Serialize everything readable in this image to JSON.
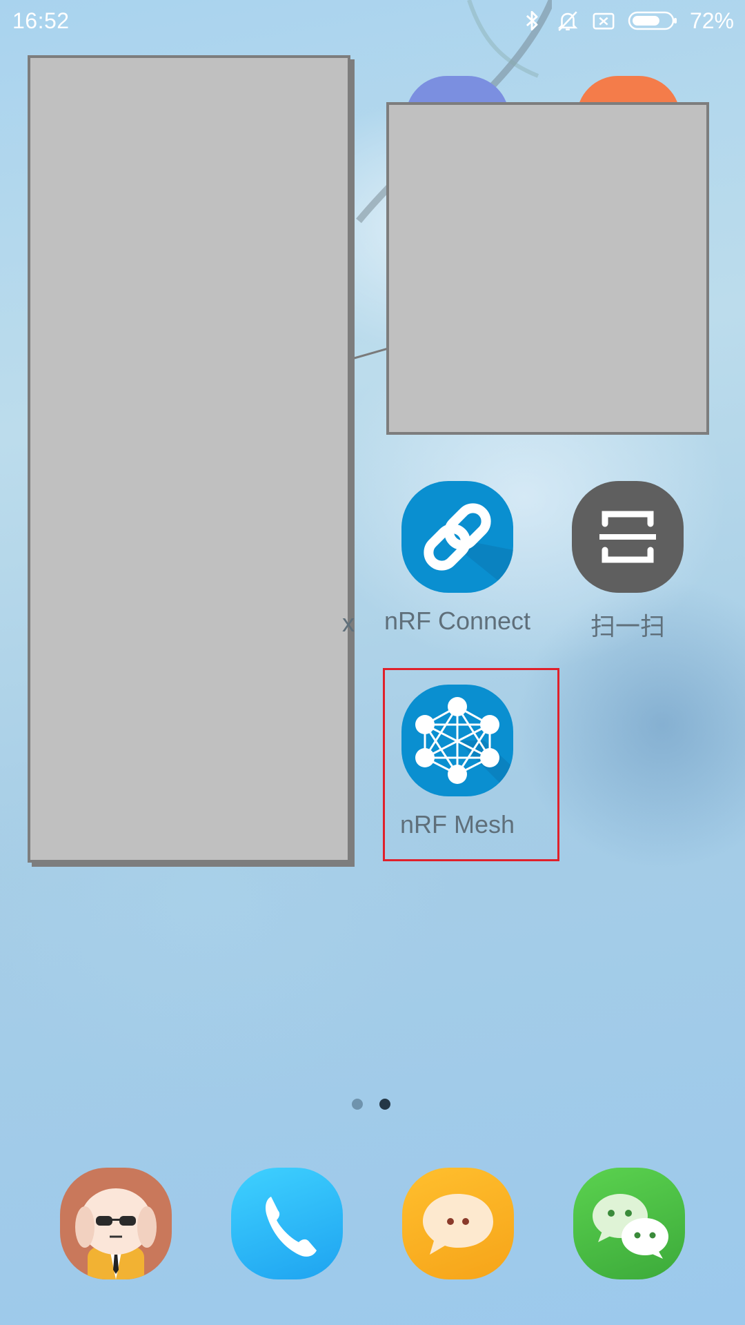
{
  "status_bar": {
    "time": "16:52",
    "battery_percent": "72%",
    "battery_level": 0.72,
    "icons": [
      "bluetooth-icon",
      "bell-muted-icon",
      "no-sim-icon",
      "battery-icon"
    ]
  },
  "home": {
    "apps": [
      {
        "label": "nRF Connect",
        "icon": "linked-chain-icon",
        "color": "#0a8fd0"
      },
      {
        "label": "扫一扫",
        "icon": "scan-frame-icon",
        "color": "#5f5f5f"
      },
      {
        "label": "nRF Mesh",
        "icon": "mesh-network-icon",
        "color": "#0a8fd0"
      }
    ],
    "truncated_label": "x",
    "highlight_color": "#e0202a"
  },
  "page_indicator": {
    "current": 2,
    "total": 2
  },
  "dock": {
    "apps": [
      {
        "icon": "mascot-dog-icon"
      },
      {
        "icon": "phone-icon"
      },
      {
        "icon": "messages-bubble-icon"
      },
      {
        "icon": "wechat-icon"
      }
    ]
  }
}
